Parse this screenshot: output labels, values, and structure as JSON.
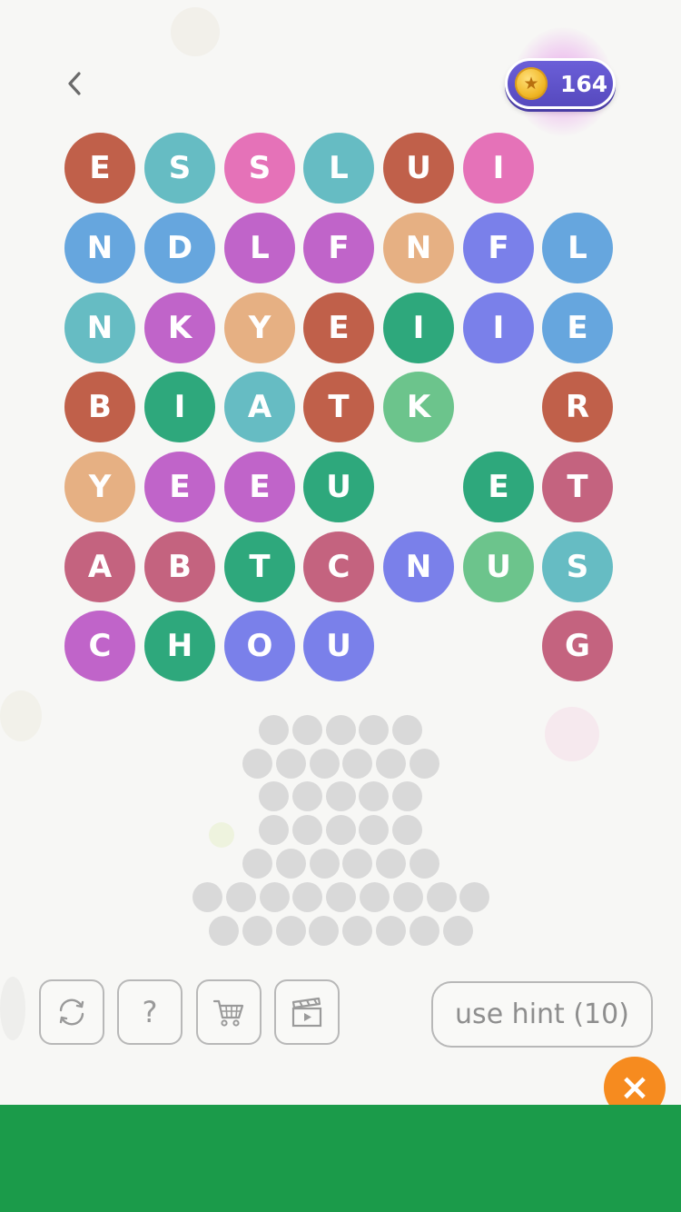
{
  "header": {
    "coins": "164"
  },
  "colors": {
    "rust": "#c0604a",
    "teal": "#66bcc3",
    "pink": "#e572b8",
    "blue": "#66a6de",
    "purple": "#c064c9",
    "peach": "#e6b083",
    "indigo": "#7a80ea",
    "green": "#2ea87c",
    "mint": "#6cc48c",
    "rose": "#c4637f"
  },
  "board": {
    "rows": [
      [
        {
          "l": "E",
          "c": "rust"
        },
        {
          "l": "S",
          "c": "teal"
        },
        {
          "l": "S",
          "c": "pink"
        },
        {
          "l": "L",
          "c": "teal"
        },
        {
          "l": "U",
          "c": "rust"
        },
        {
          "l": "I",
          "c": "pink"
        },
        null
      ],
      [
        {
          "l": "N",
          "c": "blue"
        },
        {
          "l": "D",
          "c": "blue"
        },
        {
          "l": "L",
          "c": "purple"
        },
        {
          "l": "F",
          "c": "purple"
        },
        {
          "l": "N",
          "c": "peach"
        },
        {
          "l": "F",
          "c": "indigo"
        },
        {
          "l": "L",
          "c": "blue"
        }
      ],
      [
        {
          "l": "N",
          "c": "teal"
        },
        {
          "l": "K",
          "c": "purple"
        },
        {
          "l": "Y",
          "c": "peach"
        },
        {
          "l": "E",
          "c": "rust"
        },
        {
          "l": "I",
          "c": "green"
        },
        {
          "l": "I",
          "c": "indigo"
        },
        {
          "l": "E",
          "c": "blue"
        }
      ],
      [
        {
          "l": "B",
          "c": "rust"
        },
        {
          "l": "I",
          "c": "green"
        },
        {
          "l": "A",
          "c": "teal"
        },
        {
          "l": "T",
          "c": "rust"
        },
        {
          "l": "K",
          "c": "mint"
        },
        null,
        {
          "l": "R",
          "c": "rust"
        }
      ],
      [
        {
          "l": "Y",
          "c": "peach"
        },
        {
          "l": "E",
          "c": "purple"
        },
        {
          "l": "E",
          "c": "purple"
        },
        {
          "l": "U",
          "c": "green"
        },
        null,
        {
          "l": "E",
          "c": "green"
        },
        {
          "l": "T",
          "c": "rose"
        }
      ],
      [
        {
          "l": "A",
          "c": "rose"
        },
        {
          "l": "B",
          "c": "rose"
        },
        {
          "l": "T",
          "c": "green"
        },
        {
          "l": "C",
          "c": "rose"
        },
        {
          "l": "N",
          "c": "indigo"
        },
        {
          "l": "U",
          "c": "mint"
        },
        {
          "l": "S",
          "c": "teal"
        }
      ],
      [
        {
          "l": "C",
          "c": "purple"
        },
        {
          "l": "H",
          "c": "green"
        },
        {
          "l": "O",
          "c": "indigo"
        },
        {
          "l": "U",
          "c": "indigo"
        },
        null,
        null,
        {
          "l": "G",
          "c": "rose"
        }
      ]
    ]
  },
  "answer_slots": {
    "row_counts": [
      5,
      6,
      5,
      5,
      6,
      9,
      8
    ]
  },
  "toolbar": {
    "buttons": [
      {
        "name": "shuffle-button",
        "icon": "shuffle-icon"
      },
      {
        "name": "help-button",
        "icon": "question-mark-icon"
      },
      {
        "name": "shop-button",
        "icon": "cart-icon"
      },
      {
        "name": "watch-video-button",
        "icon": "clapperboard-icon"
      }
    ],
    "help_glyph": "?",
    "hint_label": "use hint (10)"
  },
  "ad_close_label": "×"
}
